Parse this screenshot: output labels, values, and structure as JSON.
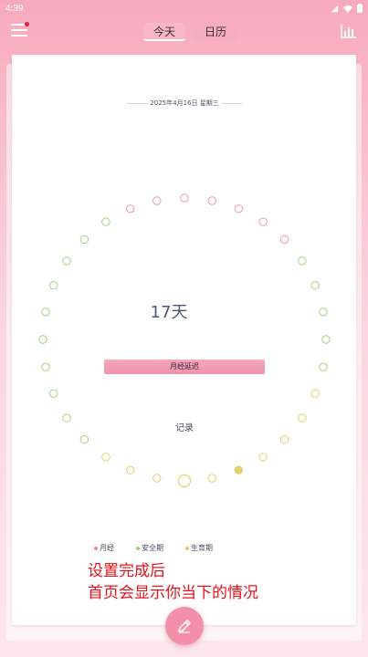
{
  "status_bar": {
    "time": "4:39",
    "icons": [
      "signal-icon",
      "wifi-icon",
      "battery-icon"
    ]
  },
  "header": {
    "menu_icon": "menu-icon",
    "has_notification_dot": true,
    "tabs": [
      {
        "label": "今天",
        "active": true
      },
      {
        "label": "日历",
        "active": false
      }
    ],
    "stats_icon": "bar-chart-icon"
  },
  "card": {
    "date": "2025年4月16日 星期三",
    "day_count": "17天",
    "status_label": "月经延迟",
    "record_label": "记录"
  },
  "cycle_ring": {
    "total_days": 32,
    "today_index": 16,
    "ovulation_index": 14,
    "phases": {
      "period": {
        "color": "#e79ab4"
      },
      "safe": {
        "color": "#a6cf7e"
      },
      "fertile": {
        "color": "#e6cf6a"
      }
    }
  },
  "legend": [
    {
      "label": "月经",
      "color": "#e9869f"
    },
    {
      "label": "安全期",
      "color": "#9fcd72"
    },
    {
      "label": "生育期",
      "color": "#e9c64f"
    }
  ],
  "overlay_caption": {
    "line1": "设置完成后",
    "line2": "首页会显示你当下的情况"
  },
  "fab": {
    "icon": "edit-pencil-icon"
  }
}
